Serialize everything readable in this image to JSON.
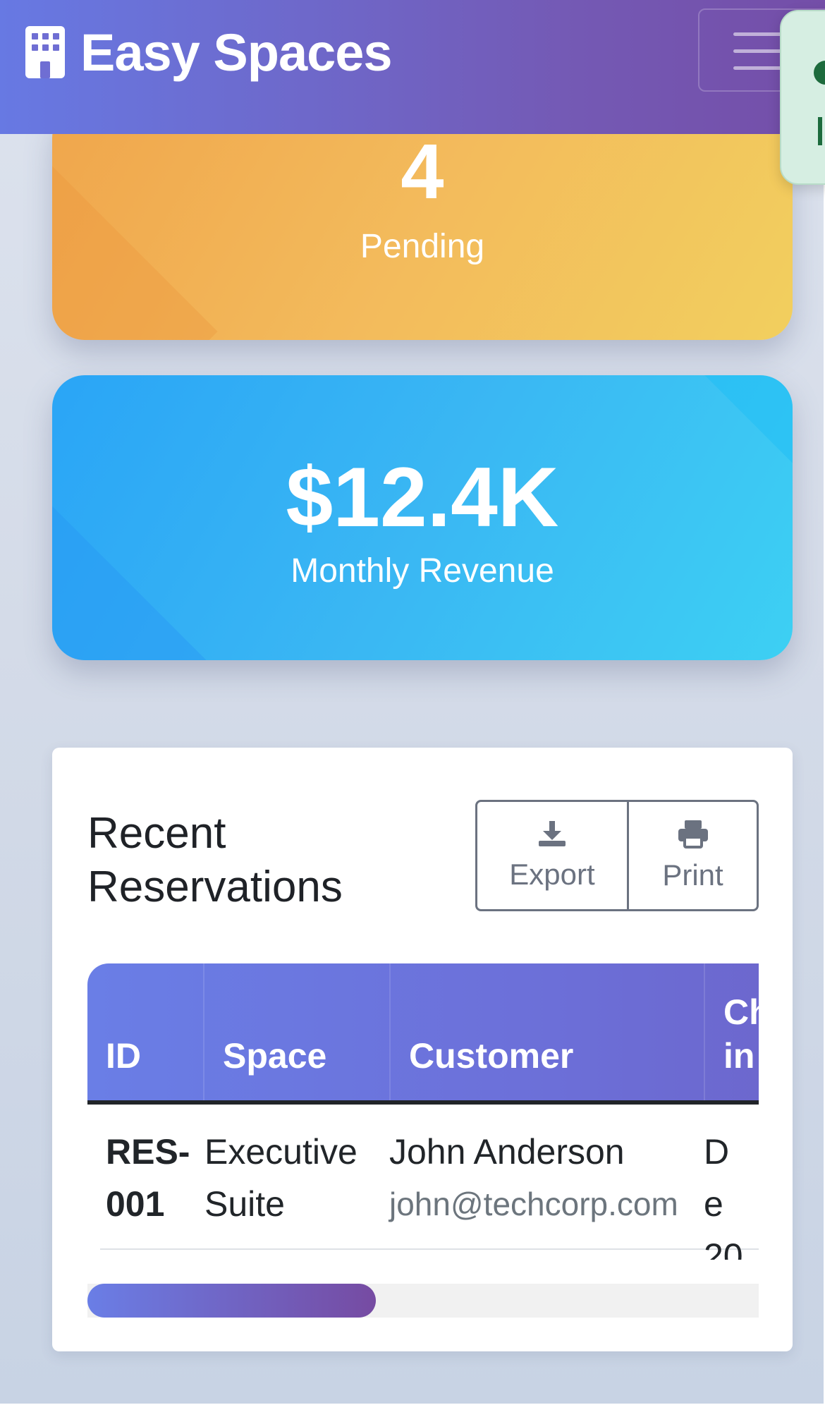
{
  "navbar": {
    "brand": "Easy Spaces",
    "brand_icon": "building-icon",
    "menu_icon": "hamburger-menu-icon"
  },
  "stats": {
    "pending": {
      "value": "4",
      "label": "Pending"
    },
    "revenue": {
      "value": "$12.4K",
      "label": "Monthly Revenue"
    }
  },
  "reservations": {
    "title": "Recent Reservations",
    "actions": {
      "export_label": "Export",
      "export_icon": "download-icon",
      "print_label": "Print",
      "print_icon": "printer-icon"
    },
    "columns": [
      "ID",
      "Space",
      "Customer",
      "Ch in"
    ],
    "rows": [
      {
        "id": "RES-001",
        "space": "Executive Suite",
        "customer_name": "John Anderson",
        "customer_email": "john@techcorp.com",
        "check_in_partial": "De 20"
      }
    ],
    "horizontal_scroll_fraction": 0.43
  },
  "colors": {
    "header_start": "#6779e3",
    "header_end": "#744ea8",
    "pending_start": "#f0a64c",
    "pending_end": "#f2cf5e",
    "revenue_start": "#2aa5f6",
    "revenue_end": "#3dd0f3",
    "toast_bg": "#d6eee2"
  }
}
